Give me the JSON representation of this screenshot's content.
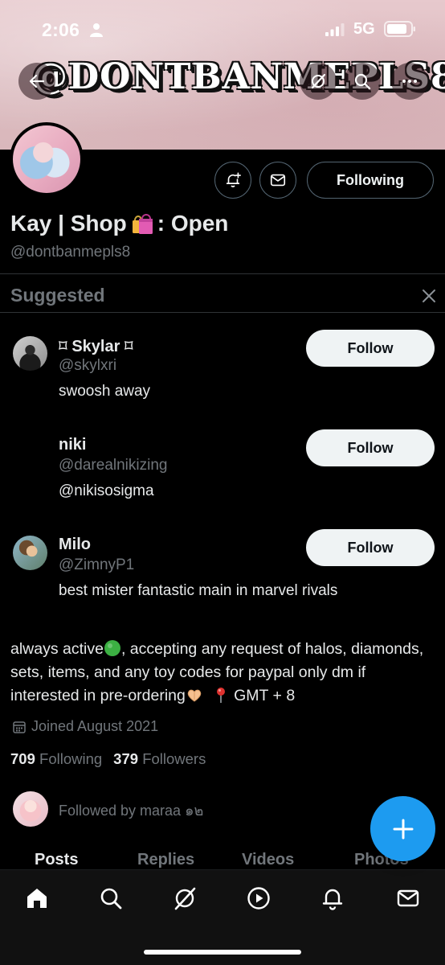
{
  "status_bar": {
    "time": "2:06",
    "network": "5G"
  },
  "header": {
    "banner_text": "@DONTBANMEPLS8",
    "buttons": [
      "back-icon",
      "grok-icon",
      "search-icon",
      "more-icon"
    ]
  },
  "profile": {
    "display_name": "Kay | Shop",
    "display_name_suffix": ": Open",
    "handle": "@dontbanmepls8",
    "following_button": "Following",
    "bio_part1": "always active",
    "bio_part2": ", accepting any request of halos, diamonds, sets, items, and any toy codes for paypal only dm if interested in pre-ordering",
    "bio_part3": "GMT + 8",
    "joined": "Joined August 2021",
    "following_count": "709",
    "following_label": "Following",
    "followers_count": "379",
    "followers_label": "Followers",
    "followed_by": "Followed by maraa ๑๒"
  },
  "suggested": {
    "title": "Suggested",
    "items": [
      {
        "name": "⌑ Skylar ⌑",
        "handle": "@skylxri",
        "bio": "swoosh away",
        "button": "Follow"
      },
      {
        "name": "niki",
        "handle": "@darealnikizing",
        "bio": "@nikisosigma",
        "button": "Follow"
      },
      {
        "name": "Milo",
        "handle": "@ZimnyP1",
        "bio": "best mister fantastic main in marvel rivals",
        "button": "Follow"
      }
    ]
  },
  "tabs": [
    "Posts",
    "Replies",
    "Videos",
    "Photos"
  ],
  "bottom_nav": [
    "home-icon",
    "search-icon",
    "grok-icon",
    "play-icon",
    "bell-icon",
    "mail-icon"
  ],
  "colors": {
    "background": "#000000",
    "text_primary": "#e7e9ea",
    "text_secondary": "#71767b",
    "accent": "#1d9bf0",
    "follow_button": "#eff3f4",
    "banner": "#dcbcc0"
  }
}
